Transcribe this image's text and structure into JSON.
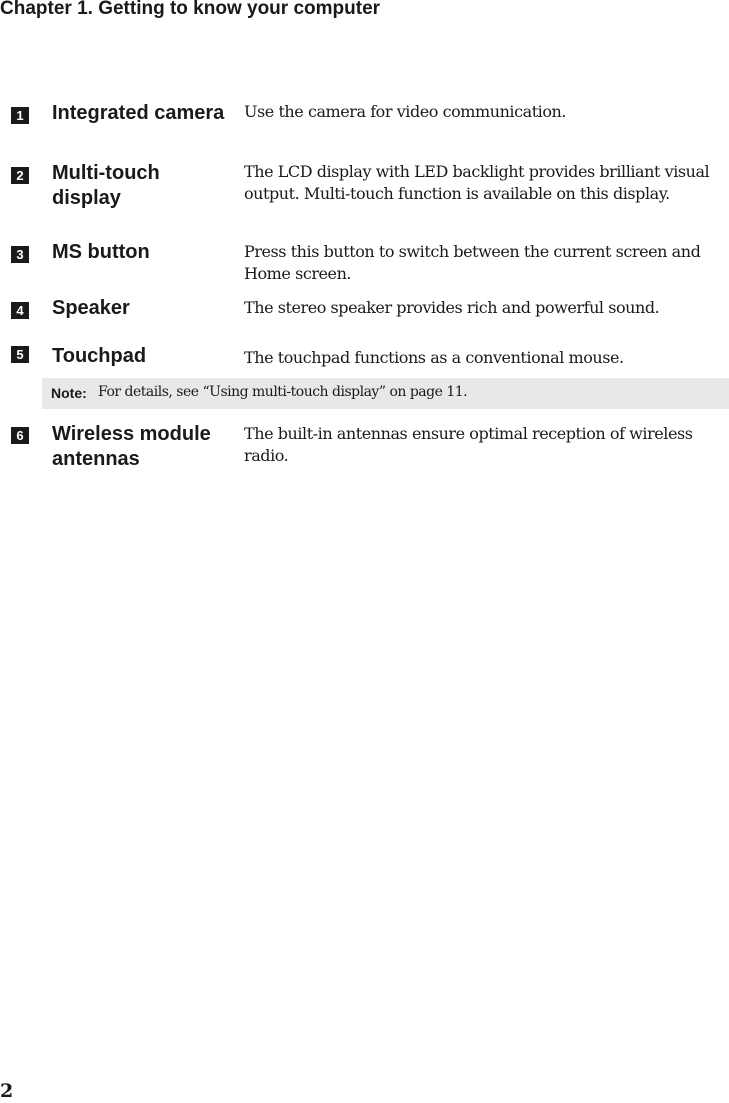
{
  "header": {
    "chapter_title": "Chapter 1. Getting to know your computer"
  },
  "items": [
    {
      "number": "1",
      "term": "Integrated camera",
      "description": "Use the camera for video communication."
    },
    {
      "number": "2",
      "term": "Multi-touch display",
      "description": "The LCD display with LED backlight provides brilliant visual output. Multi-touch function is available on this display."
    },
    {
      "number": "3",
      "term": "MS button",
      "description": "Press this button to switch between the current screen and Home screen."
    },
    {
      "number": "4",
      "term": "Speaker",
      "description": "The stereo speaker provides rich and powerful sound."
    },
    {
      "number": "5",
      "term": "Touchpad",
      "description": "The touchpad functions as a conventional mouse."
    },
    {
      "number": "6",
      "term": "Wireless module antennas",
      "description": "The built-in antennas ensure optimal reception of wireless radio."
    }
  ],
  "note": {
    "label": "Note:",
    "text": "For details, see “Using multi-touch display” on page 11."
  },
  "footer": {
    "page_number": "2"
  }
}
